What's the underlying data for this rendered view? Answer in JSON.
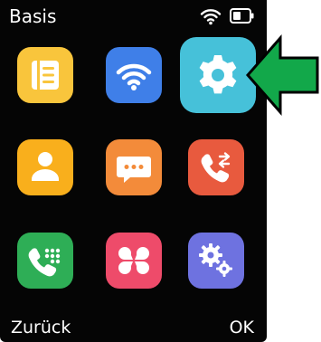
{
  "status_bar": {
    "title": "Basis"
  },
  "softkeys": {
    "left": "Zurück",
    "right": "OK"
  },
  "apps": [
    {
      "name": "notes",
      "icon": "notes-icon",
      "color": "#F9C53C",
      "selected": false
    },
    {
      "name": "wifi",
      "icon": "wifi-icon",
      "color": "#3F7FE8",
      "selected": false
    },
    {
      "name": "settings",
      "icon": "gear-icon",
      "color": "#46C1D9",
      "selected": true
    },
    {
      "name": "contacts",
      "icon": "person-icon",
      "color": "#F9AF1C",
      "selected": false
    },
    {
      "name": "messages",
      "icon": "chat-bubble-icon",
      "color": "#F38B3A",
      "selected": false
    },
    {
      "name": "call-forwarding",
      "icon": "phone-forward-icon",
      "color": "#E85A3E",
      "selected": false
    },
    {
      "name": "dialer",
      "icon": "phone-keypad-icon",
      "color": "#2EAE56",
      "selected": false
    },
    {
      "name": "apps",
      "icon": "clover-icon",
      "color": "#EE4B6A",
      "selected": false
    },
    {
      "name": "advanced-settings",
      "icon": "gears-icon",
      "color": "#6E72E0",
      "selected": false
    }
  ],
  "highlight_arrow_color": "#12A84A"
}
